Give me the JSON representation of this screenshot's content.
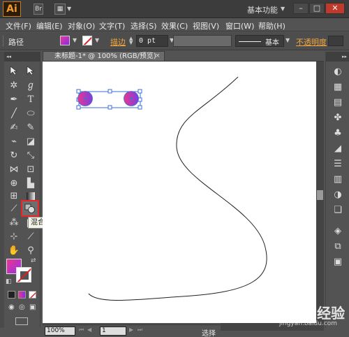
{
  "titlebar": {
    "logo": "Ai",
    "br_icon": "Br",
    "workspace": "基本功能",
    "minimize": "–",
    "maximize": "□",
    "close": "✕"
  },
  "menu": [
    "文件(F)",
    "编辑(E)",
    "对象(O)",
    "文字(T)",
    "选择(S)",
    "效果(C)",
    "视图(V)",
    "窗口(W)",
    "帮助(H)"
  ],
  "control": {
    "object_label": "路径",
    "stroke_label": "描边",
    "stroke_width": "0 pt",
    "stroke_profile": "基本",
    "opacity_label": "不透明度"
  },
  "document": {
    "tab_title": "未标题-1* @ 100% (RGB/预览)",
    "tab_close": "×"
  },
  "tooltip": "混合工具 (W)",
  "status": {
    "zoom": "100%",
    "page": "1",
    "tool": "选择"
  },
  "watermark": {
    "main": "Baidu 经验",
    "sub": "jingyan.baidu.com"
  },
  "colors": {
    "accent_link": "#f3a63b",
    "highlight_red": "#e8262a",
    "gradient_start": "#e8378f",
    "gradient_end": "#7b3fe0"
  },
  "tools_left": [
    "selection-icon",
    "magic-wand-icon",
    "pen-icon",
    "line-icon",
    "paintbrush-icon",
    "rotate-icon",
    "width-icon",
    "shape-builder-icon",
    "mesh-icon",
    "eyedropper-icon",
    "symbol-sprayer-icon",
    "artboard-icon",
    "hand-icon"
  ],
  "tools_right": [
    "direct-selection-icon",
    "lasso-icon",
    "type-icon",
    "ellipse-icon",
    "pencil-icon",
    "eraser-icon",
    "scale-icon",
    "free-transform-icon",
    "perspective-icon",
    "chart-icon",
    "gradient-icon",
    "blend-icon",
    "slice-icon",
    "zoom-icon"
  ]
}
